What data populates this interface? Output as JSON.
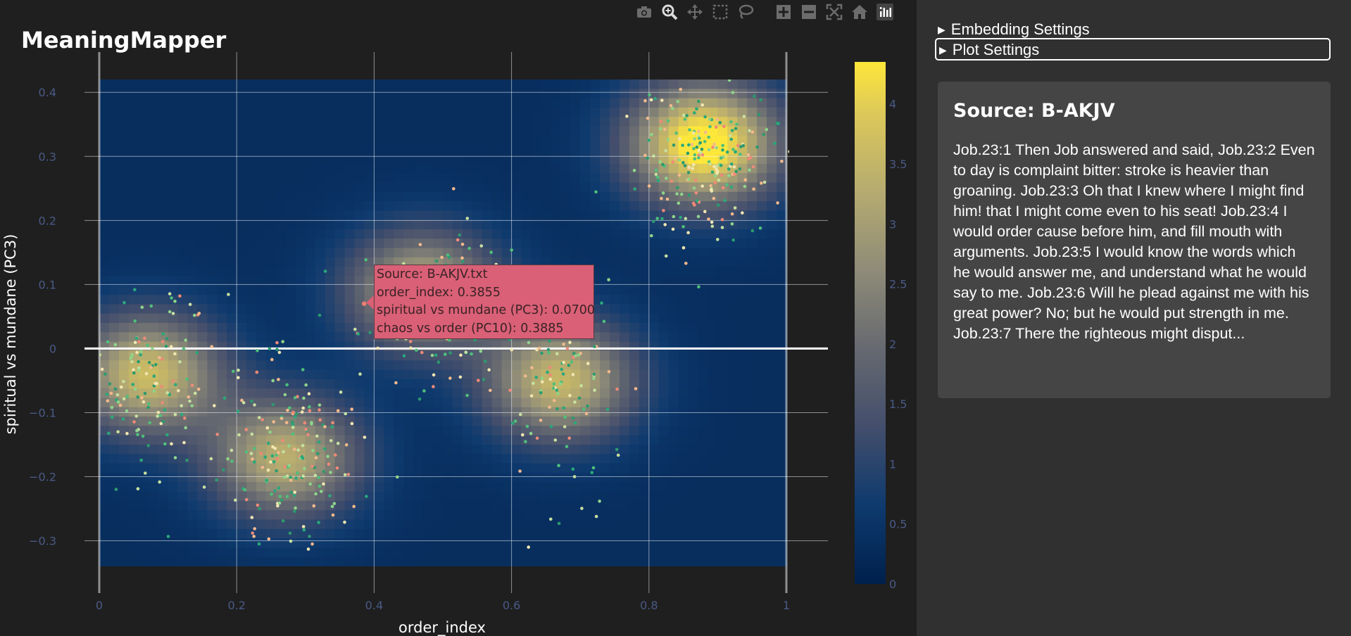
{
  "app": {
    "title": "MeaningMapper"
  },
  "modebar": [
    {
      "name": "camera-icon",
      "title": "Download plot as a png"
    },
    {
      "name": "zoom-icon",
      "title": "Zoom"
    },
    {
      "name": "pan-icon",
      "title": "Pan"
    },
    {
      "name": "box-select-icon",
      "title": "Box Select"
    },
    {
      "name": "lasso-select-icon",
      "title": "Lasso Select"
    },
    {
      "name": "zoom-in-icon",
      "title": "Zoom in"
    },
    {
      "name": "zoom-out-icon",
      "title": "Zoom out"
    },
    {
      "name": "autoscale-icon",
      "title": "Autoscale"
    },
    {
      "name": "reset-axes-icon",
      "title": "Reset axes"
    },
    {
      "name": "plotly-logo-icon",
      "title": "Produced with Plotly"
    }
  ],
  "settings": {
    "embedding_label": "Embedding Settings",
    "plot_label": "Plot Settings"
  },
  "source_panel": {
    "title": "Source: B-AKJV",
    "text": "Job.23:1 Then Job answered and said, Job.23:2 Even to day is complaint bitter: stroke is heavier than groaning. Job.23:3 Oh that I knew where I might find him! that I might come even to his seat! Job.23:4 I would order cause before him, and fill mouth with arguments. Job.23:5 I would know the words which he would answer me, and understand what he would say to me. Job.23:6 Will he plead against me with his great power? No; but he would put strength in me. Job.23:7 There the righteous might disput..."
  },
  "tooltip": {
    "source": "Source: B-AKJV.txt",
    "order_index": "order_index: 0.3855",
    "pc3": "spiritual vs mundane (PC3): 0.0700",
    "pc10": "chaos vs order (PC10): 0.3885"
  },
  "colors": {
    "accent": "#e8c54a",
    "background": "#1f1f1f",
    "panel": "#454545",
    "tooltip": "#d96076"
  },
  "chart_data": {
    "type": "scatter",
    "xlabel": "order_index",
    "ylabel": "spiritual vs mundane (PC3)",
    "xlim": [
      0,
      1
    ],
    "ylim": [
      -0.34,
      0.42
    ],
    "xticks": [
      0,
      0.2,
      0.4,
      0.6,
      0.8,
      1
    ],
    "xtick_labels": [
      "0",
      "0.2",
      "0.4",
      "0.6",
      "0.8",
      "1"
    ],
    "yticks": [
      -0.3,
      -0.2,
      -0.1,
      0,
      0.1,
      0.2,
      0.3,
      0.4
    ],
    "ytick_labels": [
      "−0.3",
      "−0.2",
      "−0.1",
      "0",
      "0.1",
      "0.2",
      "0.3",
      "0.4"
    ],
    "grid": true,
    "density_heatmap": {
      "colorscale": "cividis",
      "zmin": 0,
      "zmax": 4.35,
      "colorbar_ticks": [
        0,
        0.5,
        1,
        1.5,
        2,
        2.5,
        3,
        3.5,
        4
      ],
      "clusters": [
        {
          "x": 0.07,
          "y": -0.04,
          "peak": 3.3
        },
        {
          "x": 0.27,
          "y": -0.17,
          "peak": 3.0
        },
        {
          "x": 0.47,
          "y": 0.09,
          "peak": 3.0
        },
        {
          "x": 0.67,
          "y": -0.05,
          "peak": 3.2
        },
        {
          "x": 0.88,
          "y": 0.32,
          "peak": 4.35
        }
      ]
    },
    "point_color_variable": "chaos vs order (PC10)",
    "highlighted_point": {
      "x": 0.3855,
      "y": 0.07,
      "pc10": 0.3885
    }
  }
}
